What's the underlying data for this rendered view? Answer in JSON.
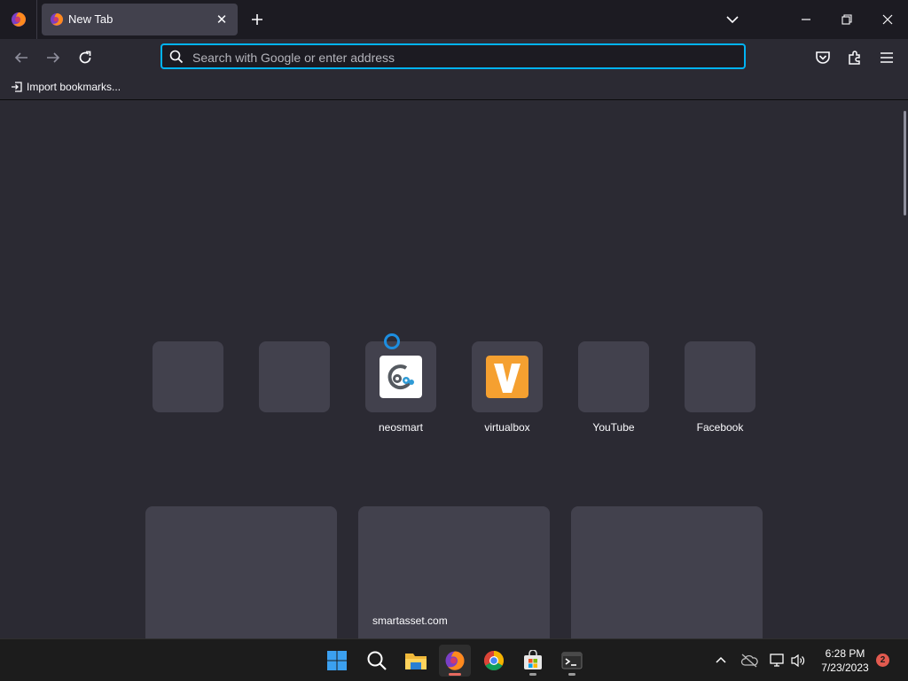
{
  "window": {
    "tab_title": "New Tab",
    "close_tab_glyph": "✕",
    "icons": [
      "firefox-menu-icon",
      "new-tab-icon",
      "list-all-tabs-icon",
      "minimize-icon",
      "restore-icon",
      "close-window-icon"
    ]
  },
  "navbar": {
    "search_placeholder": "Search with Google or enter address",
    "icons": [
      "back-icon",
      "forward-icon",
      "reload-icon",
      "pocket-icon",
      "extensions-icon",
      "menu-icon"
    ]
  },
  "bookmarks": {
    "import_label": "Import bookmarks..."
  },
  "top_sites": [
    {
      "label": "",
      "logo": ""
    },
    {
      "label": "",
      "logo": ""
    },
    {
      "label": "neosmart",
      "logo": "neosmart-logo"
    },
    {
      "label": "virtualbox",
      "logo": "virtualbox-logo"
    },
    {
      "label": "YouTube",
      "logo": ""
    },
    {
      "label": "Facebook",
      "logo": ""
    }
  ],
  "stories": [
    {
      "source": ""
    },
    {
      "source": "smartasset.com"
    },
    {
      "source": ""
    }
  ],
  "taskbar": {
    "apps": [
      "start-icon",
      "search-icon",
      "file-explorer-icon",
      "firefox-icon",
      "chrome-icon",
      "store-icon",
      "terminal-icon"
    ],
    "time": "6:28 PM",
    "date": "7/23/2023",
    "notification_count": "2"
  },
  "colors": {
    "accent": "#00b3f4",
    "tab_bg": "#42414d",
    "page_bg": "#2b2a33",
    "toolbar_dark": "#1c1b22",
    "virtualbox_orange": "#f5a030"
  }
}
